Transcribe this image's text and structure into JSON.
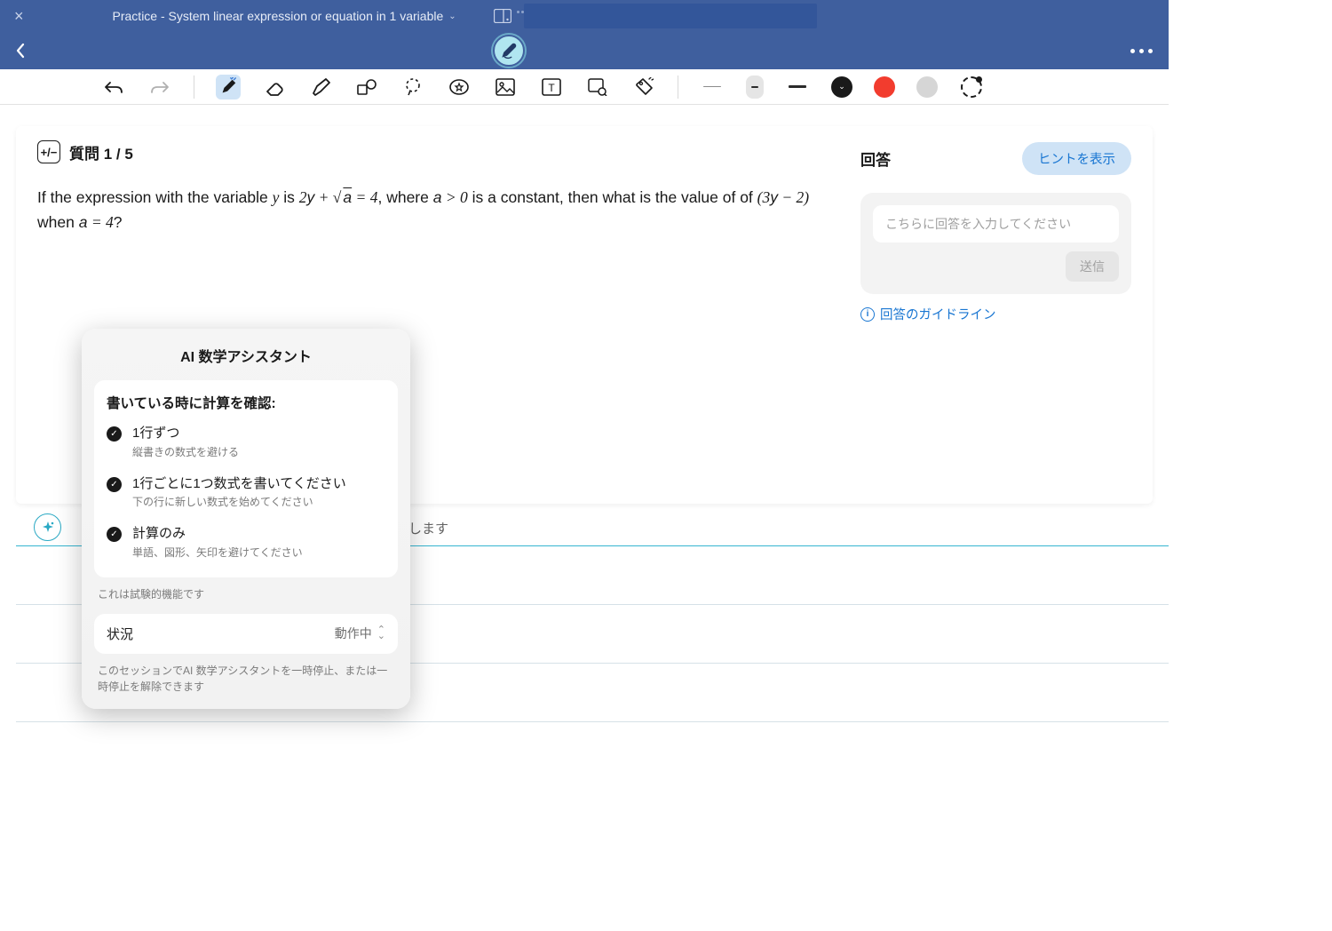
{
  "header": {
    "title": "Practice - System linear expression or equation in 1 variable"
  },
  "question": {
    "label": "質問 1 / 5",
    "text_prefix": "If the expression with the variable ",
    "var_y": "y",
    "text_is": " is ",
    "expr1": "2y + √a = 4",
    "text_where": ", where ",
    "cond": "a > 0",
    "text_const": " is a constant, then what is the value of ",
    "expr2": "(3y − 2)",
    "text_when": " when ",
    "cond2": "a = 4",
    "text_end": "?"
  },
  "answer": {
    "title": "回答",
    "hint": "ヒントを表示",
    "placeholder": "こちらに回答を入力してください",
    "send": "送信",
    "guide": "回答のガイドライン"
  },
  "work": {
    "start": "します"
  },
  "popup": {
    "title": "AI 数学アシスタント",
    "card_heading": "書いている時に計算を確認:",
    "items": [
      {
        "t1": "1行ずつ",
        "t2": "縦書きの数式を避ける"
      },
      {
        "t1": "1行ごとに1つ数式を書いてください",
        "t2": "下の行に新しい数式を始めてください"
      },
      {
        "t1": "計算のみ",
        "t2": "単語、図形、矢印を避けてください"
      }
    ],
    "note": "これは試験的機能です",
    "status_label": "状況",
    "status_value": "動作中",
    "note2": "このセッションでAI 数学アシスタントを一時停止、または一時停止を解除できます"
  }
}
